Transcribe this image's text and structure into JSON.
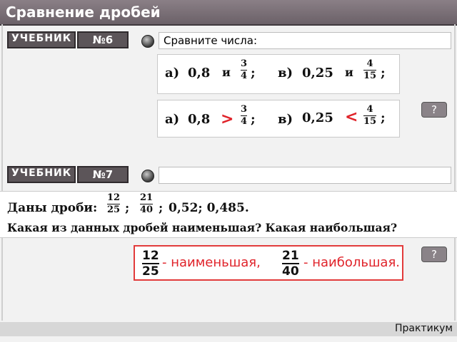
{
  "title": "Сравнение дробей",
  "task6": {
    "tag": "УЧЕБНИК",
    "number": "№6",
    "prompt": "Сравните числа:",
    "a_label": "а)",
    "a_value": "0,8",
    "and": "и",
    "a_frac": {
      "num": "3",
      "den": "4"
    },
    "v_label": "в)",
    "v_value": "0,25",
    "v_frac": {
      "num": "4",
      "den": "15"
    },
    "sep": ";",
    "answer_a_sign": ">",
    "answer_v_sign": "<",
    "help": "?"
  },
  "task7": {
    "tag": "УЧЕБНИК",
    "number": "№7",
    "prompt": "",
    "given": "Даны дроби:",
    "f1": {
      "num": "12",
      "den": "25"
    },
    "f2": {
      "num": "21",
      "den": "40"
    },
    "rest": "0,52;  0,485.",
    "sep": ";",
    "question": "Какая из данных дробей наименьшая? Какая наибольшая?",
    "ans_f1": {
      "num": "12",
      "den": "25"
    },
    "ans_min": "- наименьшая,",
    "ans_f2": {
      "num": "21",
      "den": "40"
    },
    "ans_max": "- наибольшая.",
    "help": "?"
  },
  "footer": "Практикум",
  "colors": {
    "accent": "#e0232a",
    "header": "#6b6168"
  }
}
